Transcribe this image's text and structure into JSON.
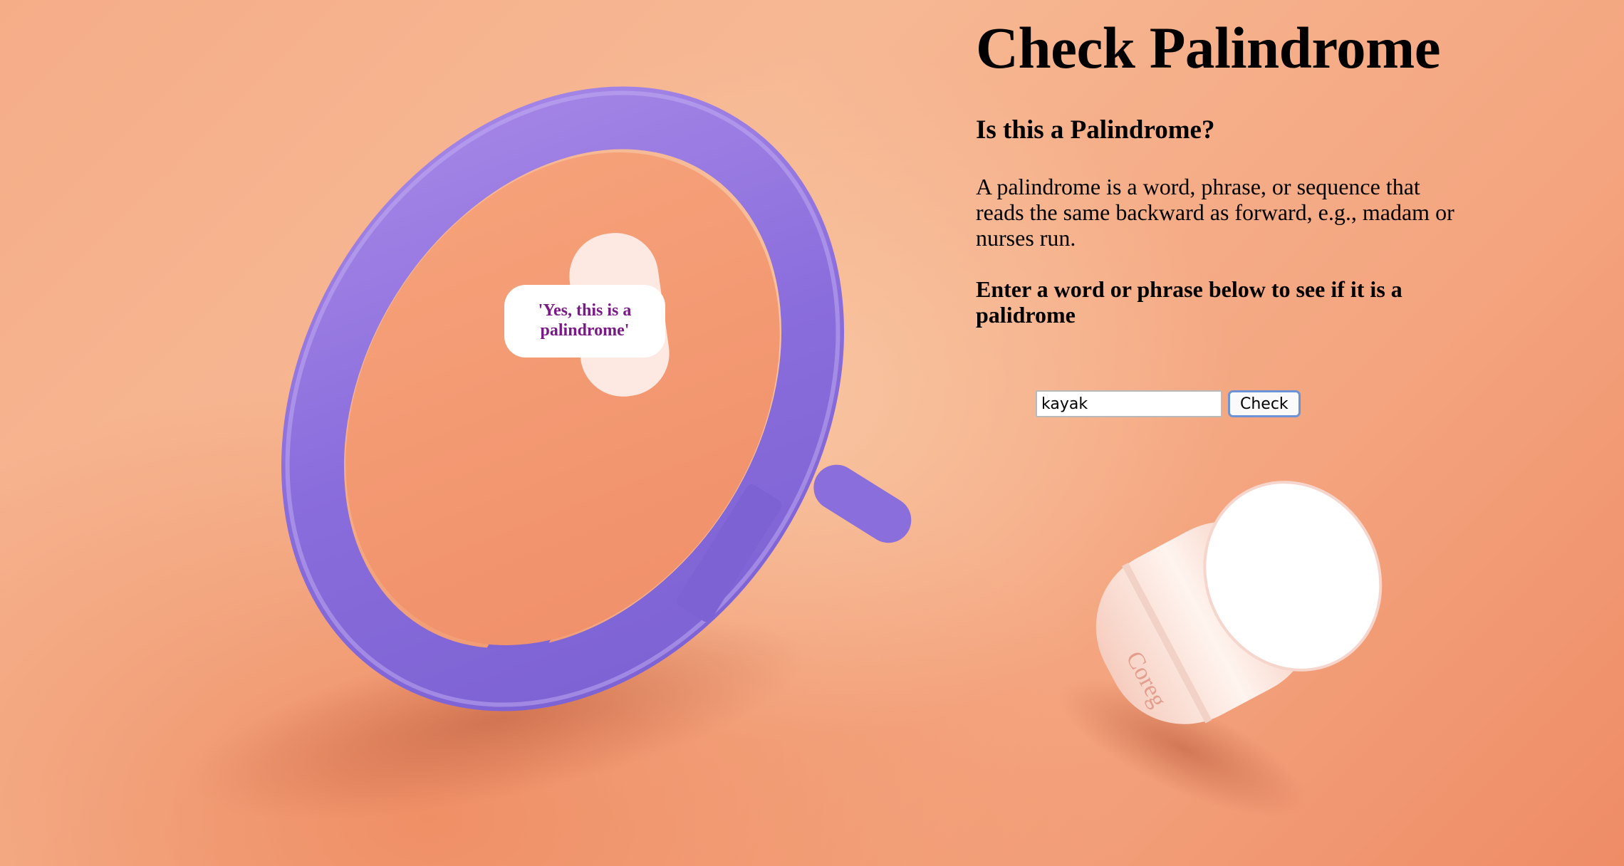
{
  "page": {
    "title": "Check Palindrome",
    "subtitle": "Is this a Palindrome?",
    "description": "A palindrome is a word, phrase, or sequence that reads the same backward as forward, e.g., madam or nurses run.",
    "instruction": "Enter a word or phrase below to see if it is a palidrome"
  },
  "form": {
    "input_value": "kayak",
    "check_label": "Check"
  },
  "result": {
    "text": "'Yes, this is a palindrome'"
  },
  "background": {
    "image_description_icons": [
      "mirror-illustration",
      "cylinder-illustration"
    ],
    "colors": {
      "backdrop": "#f5ad88",
      "mirror_frame": "#8c6fdc",
      "cylinder": "#fde8e0",
      "result_text": "#7a1a86",
      "button_border": "#6b93d6"
    }
  }
}
